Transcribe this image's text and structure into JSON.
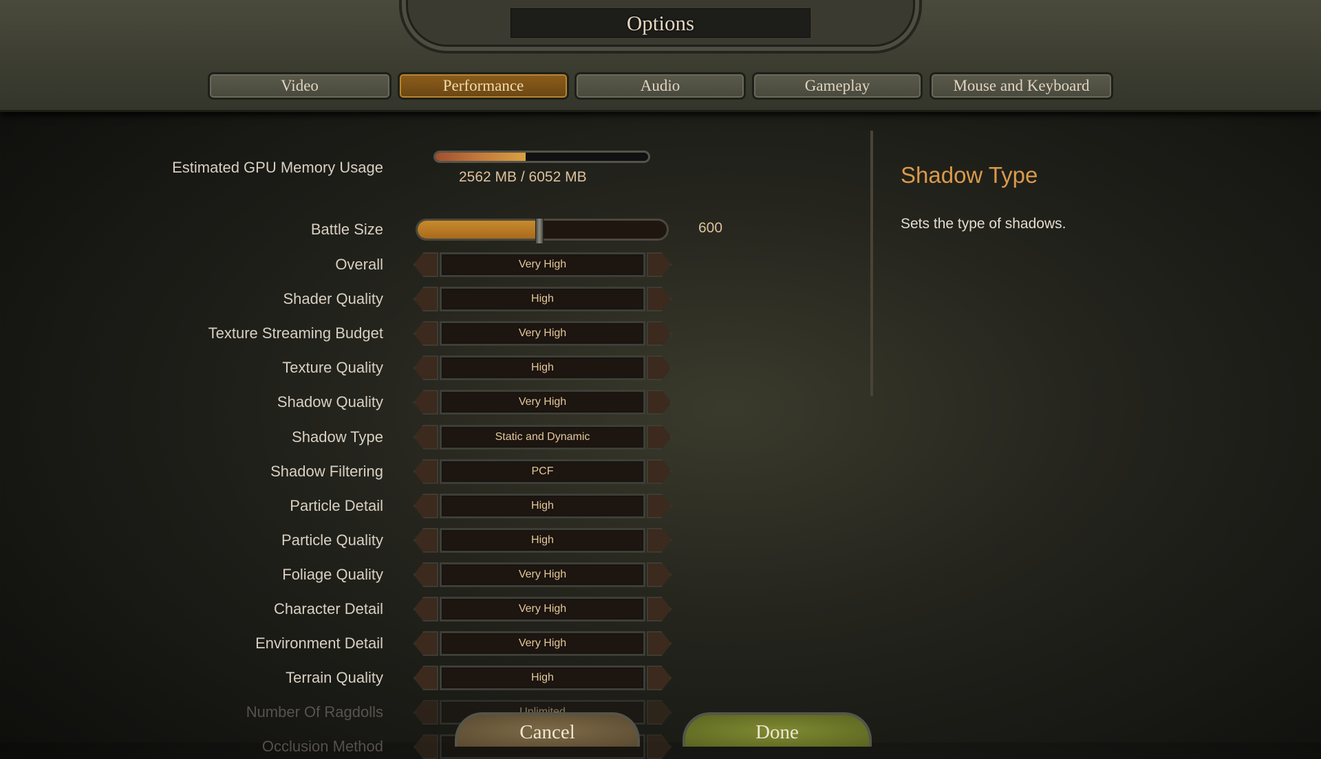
{
  "title": "Options",
  "tabs": [
    {
      "label": "Video",
      "active": false
    },
    {
      "label": "Performance",
      "active": true
    },
    {
      "label": "Audio",
      "active": false
    },
    {
      "label": "Gameplay",
      "active": false
    },
    {
      "label": "Mouse and Keyboard",
      "active": false
    }
  ],
  "gpu": {
    "label": "Estimated GPU Memory Usage",
    "usage_text": "2562 MB / 6052 MB",
    "fraction": 0.423
  },
  "battle_size": {
    "label": "Battle Size",
    "value": "600",
    "fill": 0.49
  },
  "settings": [
    {
      "label": "Overall",
      "value": "Very High"
    },
    {
      "label": "Shader Quality",
      "value": "High"
    },
    {
      "label": "Texture Streaming Budget",
      "value": "Very High"
    },
    {
      "label": "Texture Quality",
      "value": "High"
    },
    {
      "label": "Shadow Quality",
      "value": "Very High"
    },
    {
      "label": "Shadow Type",
      "value": "Static and Dynamic"
    },
    {
      "label": "Shadow Filtering",
      "value": "PCF"
    },
    {
      "label": "Particle Detail",
      "value": "High"
    },
    {
      "label": "Particle Quality",
      "value": "High"
    },
    {
      "label": "Foliage Quality",
      "value": "Very High"
    },
    {
      "label": "Character Detail",
      "value": "Very High"
    },
    {
      "label": "Environment Detail",
      "value": "Very High"
    },
    {
      "label": "Terrain Quality",
      "value": "High"
    },
    {
      "label": "Number Of Ragdolls",
      "value": "Unlimited"
    },
    {
      "label": "Occlusion Method",
      "value": ""
    }
  ],
  "info": {
    "title": "Shadow Type",
    "description": "Sets the type of shadows."
  },
  "buttons": {
    "cancel": "Cancel",
    "done": "Done"
  },
  "colors": {
    "accent": "#d99a4a",
    "active_tab": "#7a5018",
    "done": "#6f7a2a",
    "cancel": "#6e5e40"
  }
}
